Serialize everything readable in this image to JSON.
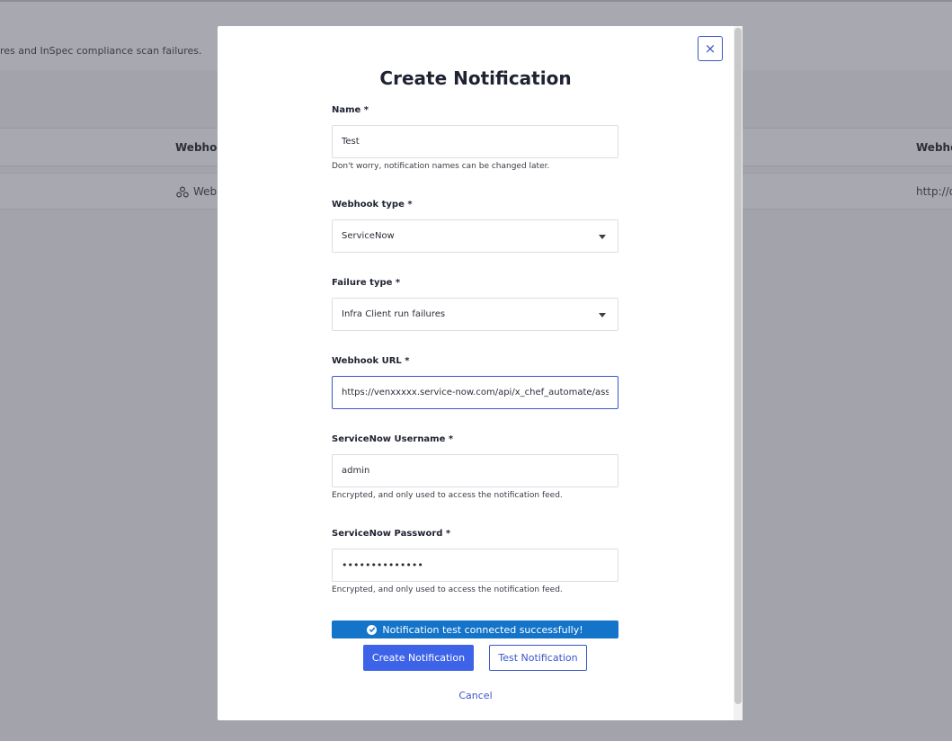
{
  "background": {
    "description": "res and InSpec compliance scan failures.",
    "columns": [
      "Webhook",
      "Webho"
    ],
    "row": {
      "type": "Webl",
      "url": "http://d"
    }
  },
  "modal": {
    "title": "Create Notification",
    "close_symbol": "×",
    "fields": [
      {
        "label": "Name *",
        "value": "Test",
        "help": "Don't worry, notification names can be changed later."
      },
      {
        "label": "Webhook type *",
        "value": "ServiceNow"
      },
      {
        "label": "Failure type *",
        "value": "Infra Client run failures"
      },
      {
        "label": "Webhook URL *",
        "value": "https://venxxxxx.service-now.com/api/x_chef_automate/asset"
      },
      {
        "label": "ServiceNow Username *",
        "value": "admin",
        "help": "Encrypted, and only used to access the notification feed."
      },
      {
        "label": "ServiceNow Password *",
        "value": "••••••••••••••",
        "help": "Encrypted, and only used to access the notification feed."
      }
    ],
    "success_message": "Notification test connected successfully!",
    "create_button": "Create Notification",
    "test_button": "Test Notification",
    "cancel_link": "Cancel"
  },
  "colors": {
    "accent": "#3d63e8",
    "success": "#1474c9",
    "overlay": "#a3a4ab"
  }
}
